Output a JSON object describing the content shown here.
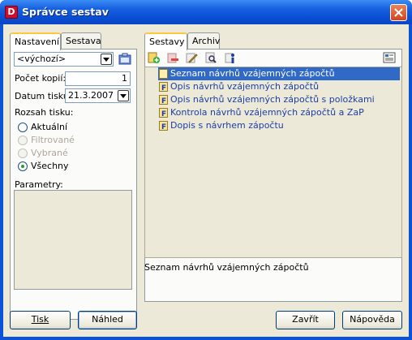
{
  "window": {
    "title": "Správce sestav"
  },
  "left_tabs": [
    {
      "label": "Nastavení"
    },
    {
      "label": "Sestava"
    }
  ],
  "left": {
    "template_combo": {
      "value": "<výchozí>"
    },
    "copies": {
      "label": "Počet kopií:",
      "value": "1"
    },
    "date": {
      "label": "Datum tisku:",
      "value": "21.3.2007"
    },
    "range": {
      "label": "Rozsah tisku:",
      "options": [
        {
          "label": "Aktuální",
          "checked": false,
          "disabled": false
        },
        {
          "label": "Filtrované",
          "checked": false,
          "disabled": true
        },
        {
          "label": "Vybrané",
          "checked": false,
          "disabled": true
        },
        {
          "label": "Všechny",
          "checked": true,
          "disabled": false
        }
      ]
    },
    "params_label": "Parametry:"
  },
  "right_tabs": [
    {
      "label": "Sestavy"
    },
    {
      "label": "Archiv"
    }
  ],
  "reports": [
    {
      "name": "Seznam návrhů vzájemných zápočtů",
      "icon": "document-icon",
      "selected": true
    },
    {
      "name": "Opis návrhů vzájemných zápočtů",
      "icon": "form-icon",
      "selected": false
    },
    {
      "name": "Opis návrhů vzájemných zápočtů s položkami",
      "icon": "form-icon",
      "selected": false
    },
    {
      "name": "Kontrola návrhů vzájemných zápočtů a ZaP",
      "icon": "form-icon",
      "selected": false
    },
    {
      "name": "Dopis s návrhem zápočtu",
      "icon": "form-icon",
      "selected": false
    }
  ],
  "description": "Seznam návrhů vzájemných zápočtů",
  "buttons": {
    "print": "Tisk",
    "preview": "Náhled",
    "close": "Zavřít",
    "help": "Nápověda"
  },
  "colors": {
    "title_bar": "#0a52d8",
    "selection": "#3169c6",
    "tab_highlight": "#ffc83c"
  }
}
